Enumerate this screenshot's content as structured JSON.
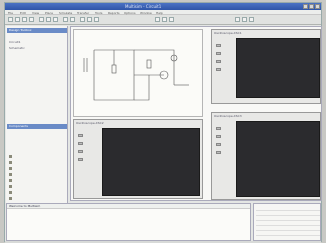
{
  "app": {
    "title": "Multisim - Circuit1"
  },
  "menu": {
    "items": [
      "File",
      "Edit",
      "View",
      "Place",
      "Simulate",
      "Transfer",
      "Tools",
      "Reports",
      "Options",
      "Window",
      "Help"
    ]
  },
  "toolbar": {
    "icons": [
      "new-icon",
      "open-icon",
      "save-icon",
      "print-icon",
      "cut-icon",
      "copy-icon",
      "paste-icon",
      "undo-icon",
      "redo-icon",
      "zoom-in-icon",
      "zoom-out-icon",
      "zoom-fit-icon",
      "run-icon",
      "pause-icon",
      "stop-icon",
      "probe-icon",
      "grapher-icon",
      "postprocessor-icon"
    ]
  },
  "left_pane": {
    "title": "Design Toolbox",
    "tree": [
      "Circuit1",
      "Schematic"
    ],
    "list_title": "Components",
    "files": [
      "",
      "",
      "",
      "",
      "",
      "",
      "",
      "",
      "",
      "",
      "",
      "",
      "",
      ""
    ]
  },
  "scopes": [
    {
      "name": "Oscilloscope-XSC1"
    },
    {
      "name": "Oscilloscope-XSC2"
    },
    {
      "name": "Oscilloscope-XSC3"
    }
  ],
  "output": {
    "title": "Welcome to Multisim",
    "lines": [
      "",
      "",
      ""
    ]
  },
  "properties": {
    "rows": [
      "",
      "",
      "",
      "",
      "",
      ""
    ]
  }
}
